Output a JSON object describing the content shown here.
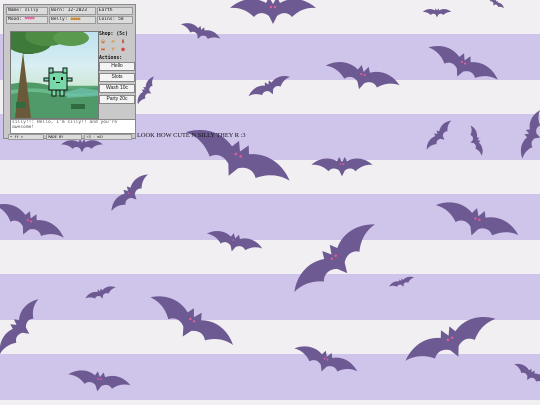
{
  "colors": {
    "bat": "#6e5a93",
    "bat_eye": "#e05c9a",
    "stripe_light": "#f1eff1",
    "stripe_lilac": "#cfc4ea",
    "pet": "#77d8a8"
  },
  "widget": {
    "stats": {
      "name": "Name: silly",
      "born": "Born: 12-2023",
      "location": "Earth",
      "mood_label": "Mood:",
      "mood_hearts": "♥♥♥♥",
      "belly_label": "Belly:",
      "belly_icons": "●●●●",
      "coins": "Coins: 58"
    },
    "shop": {
      "title": "Shop: (5c)",
      "icons": [
        "burger-icon",
        "cake-icon",
        "drink-icon",
        "candy-icon",
        "icecream-icon",
        "potion-icon"
      ]
    },
    "actions": {
      "title": "Actions:",
      "buttons": [
        "Hello",
        "Slots",
        "Wash 10c",
        "Party 20c"
      ]
    },
    "chat_text": "silly!!: Hello, I'm silly!! and you're awesome!",
    "footer": [
      "• ff >",
      "MADE BY",
      "<3 · m3!"
    ]
  },
  "caption": "LOOK HOW CUTE N SILLY THEY R :3"
}
